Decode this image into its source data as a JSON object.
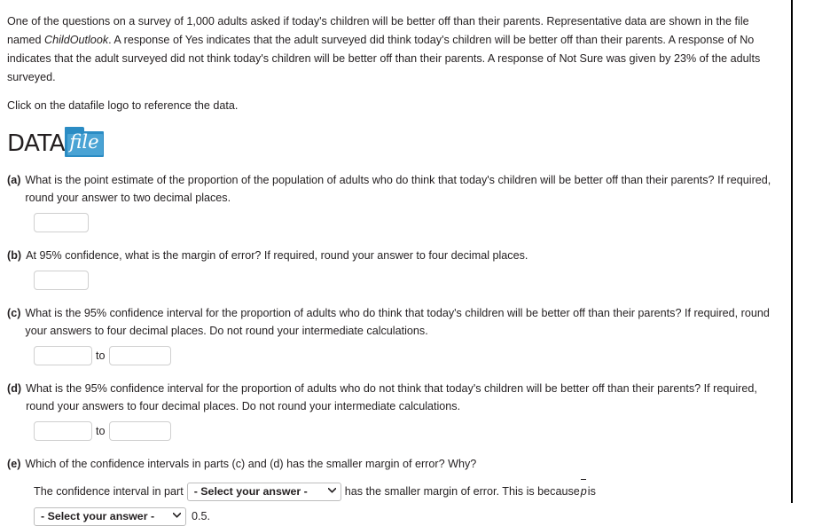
{
  "intro": {
    "sentence1_pre": "One of the questions on a survey of 1,000 adults asked if today's children will be better off than their parents. Representative data are shown in the file named ",
    "file_name": "ChildOutlook",
    "sentence1_post": ". A response of Yes indicates that the adult surveyed did think today's children will be better off than their parents. A response of No indicates that the adult surveyed did not think today's children will be better off than their parents. A response of Not Sure was given by 23% of the adults surveyed.",
    "click_line": "Click on the datafile logo to reference the data."
  },
  "datafile_logo": {
    "word": "DATA",
    "folder_label": "file",
    "folder_color": "#2b8cc4",
    "folder_front_color": "#4aa3d4"
  },
  "parts": {
    "a": {
      "marker": "(a)",
      "text": "What is the point estimate of the proportion of the population of adults who do think that today's children will be better off than their parents? If required, round your answer to two decimal places.",
      "input_value": ""
    },
    "b": {
      "marker": "(b)",
      "text": "At 95% confidence, what is the margin of error? If required, round your answer to four decimal places.",
      "input_value": ""
    },
    "c": {
      "marker": "(c)",
      "text": "What is the 95% confidence interval for the proportion of adults who do think that today's children will be better off than their parents? If required, round your answers to four decimal places. Do not round your intermediate calculations.",
      "lower_value": "",
      "upper_value": "",
      "separator": "to"
    },
    "d": {
      "marker": "(d)",
      "text": "What is the 95% confidence interval for the proportion of adults who do not think that today's children will be better off than their parents? If required, round your answers to four decimal places. Do not round your intermediate calculations.",
      "lower_value": "",
      "upper_value": "",
      "separator": "to"
    },
    "e": {
      "marker": "(e)",
      "text": "Which of the confidence intervals in parts (c) and (d) has the smaller margin of error? Why?",
      "lead_text": "The confidence interval in part",
      "select1_value": "- Select your answer -",
      "mid_text": "has the smaller margin of error. This is because",
      "p_symbol": "p",
      "after_p_text": "is",
      "select2_value": "- Select your answer -",
      "tail_text": "0.5.",
      "caret": "⌄"
    }
  }
}
